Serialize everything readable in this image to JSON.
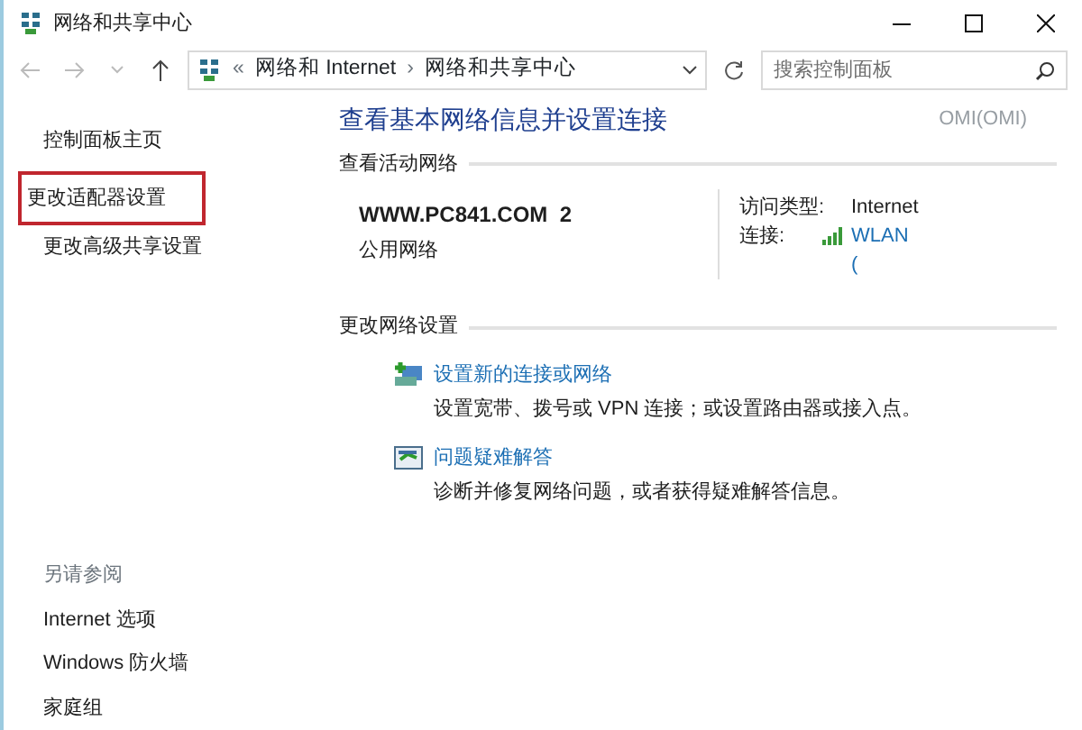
{
  "window": {
    "title": "网络和共享中心"
  },
  "address_bar": {
    "separator": "«",
    "crumbs": [
      "网络和 Internet",
      "网络和共享中心"
    ],
    "chevron": "›"
  },
  "search": {
    "placeholder": "搜索控制面板"
  },
  "sidebar": {
    "items": [
      {
        "label": "控制面板主页",
        "highlighted": false
      },
      {
        "label": "更改适配器设置",
        "highlighted": true
      },
      {
        "label": "更改高级共享设置",
        "highlighted": false
      }
    ],
    "see_also": {
      "heading": "另请参阅",
      "items": [
        "Internet 选项",
        "Windows 防火墙",
        "家庭组"
      ]
    }
  },
  "main": {
    "title": "查看基本网络信息并设置连接",
    "corner_text": "OMI(OMI)",
    "active_networks": {
      "heading": "查看活动网络",
      "name": "WWW.PC841.COM  2",
      "type": "公用网络",
      "details": [
        {
          "label": "访问类型:",
          "value": "Internet",
          "kind": "text"
        },
        {
          "label": "连接:",
          "value": "WLAN",
          "kind": "wifi"
        },
        {
          "value": "(",
          "kind": "link"
        }
      ]
    },
    "change_settings": {
      "heading": "更改网络设置",
      "tasks": [
        {
          "kind": "new-connection",
          "link": "设置新的连接或网络",
          "description": "设置宽带、拨号或 VPN 连接；或设置路由器或接入点。"
        },
        {
          "kind": "troubleshoot",
          "link": "问题疑难解答",
          "description": "诊断并修复网络问题，或者获得疑难解答信息。"
        }
      ]
    }
  }
}
